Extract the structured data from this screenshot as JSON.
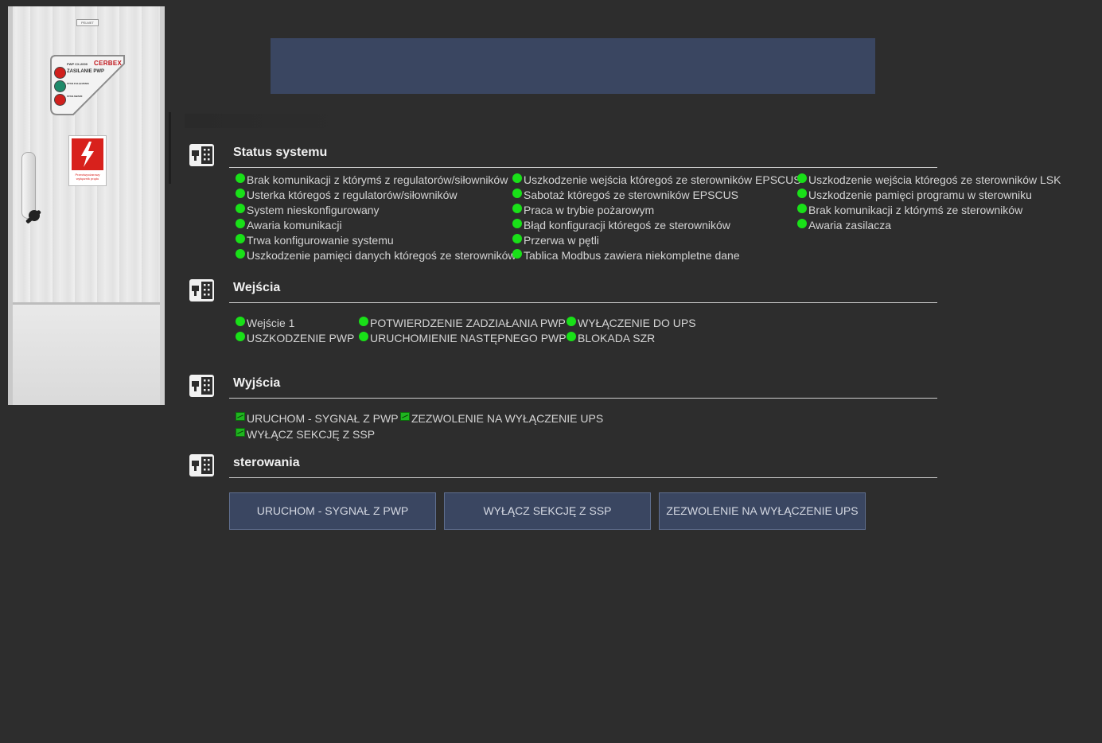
{
  "cabinet": {
    "brand": "PELMET",
    "panel_model": "PWP CX-2000",
    "panel_logo": "CERBEX",
    "panel_title": "ZASILANIE PWP",
    "lamp_label_1": "STAN ZAŁĄCZENIA",
    "lamp_label_2": "STAN AWARII",
    "sign_text": "Przeciwpożarowy wyłącznik prądu",
    "lamp_colors": [
      "#d0201d",
      "#1f8a6a",
      "#d0201d"
    ]
  },
  "colors": {
    "background": "#2d2d2d",
    "accent_bar": "#3a4661",
    "status_ok": "#19e018"
  },
  "sections": {
    "status": {
      "title": "Status systemu",
      "col1": [
        "Brak komunikacji z którymś z regulatorów/siłowników",
        "Usterka któregoś z regulatorów/siłowników",
        "System nieskonfigurowany",
        "Awaria komunikacji",
        "Trwa konfigurowanie systemu",
        "Uszkodzenie pamięci danych któregoś ze sterowników"
      ],
      "col2": [
        "Uszkodzenie wejścia któregoś ze sterowników EPSCUS",
        "Sabotaż któregoś ze sterowników EPSCUS",
        "Praca w trybie pożarowym",
        "Błąd konfiguracji któregoś ze sterowników",
        "Przerwa w pętli",
        "Tablica Modbus zawiera niekompletne dane"
      ],
      "col3": [
        "Uszkodzenie wejścia któregoś ze sterowników LSK",
        "Uszkodzenie pamięci programu w sterowniku",
        "Brak komunikacji z którymś ze sterowników",
        "Awaria zasilacza"
      ]
    },
    "inputs": {
      "title": "Wejścia",
      "col1": [
        "Wejście 1",
        "USZKODZENIE PWP"
      ],
      "col2": [
        "POTWIERDZENIE ZADZIAŁANIA PWP",
        "URUCHOMIENIE NASTĘPNEGO PWP"
      ],
      "col3": [
        "WYŁĄCZENIE DO UPS",
        "BLOKADA SZR"
      ]
    },
    "outputs": {
      "title": "Wyjścia",
      "row1": [
        "URUCHOM - SYGNAŁ Z PWP",
        "ZEZWOLENIE NA WYŁĄCZENIE UPS"
      ],
      "row2": [
        "WYŁĄCZ SEKCJĘ Z SSP"
      ]
    },
    "controls": {
      "title": "sterowania",
      "buttons": [
        "URUCHOM - SYGNAŁ Z PWP",
        "WYŁĄCZ SEKCJĘ Z SSP",
        "ZEZWOLENIE NA WYŁĄCZENIE UPS"
      ]
    }
  }
}
